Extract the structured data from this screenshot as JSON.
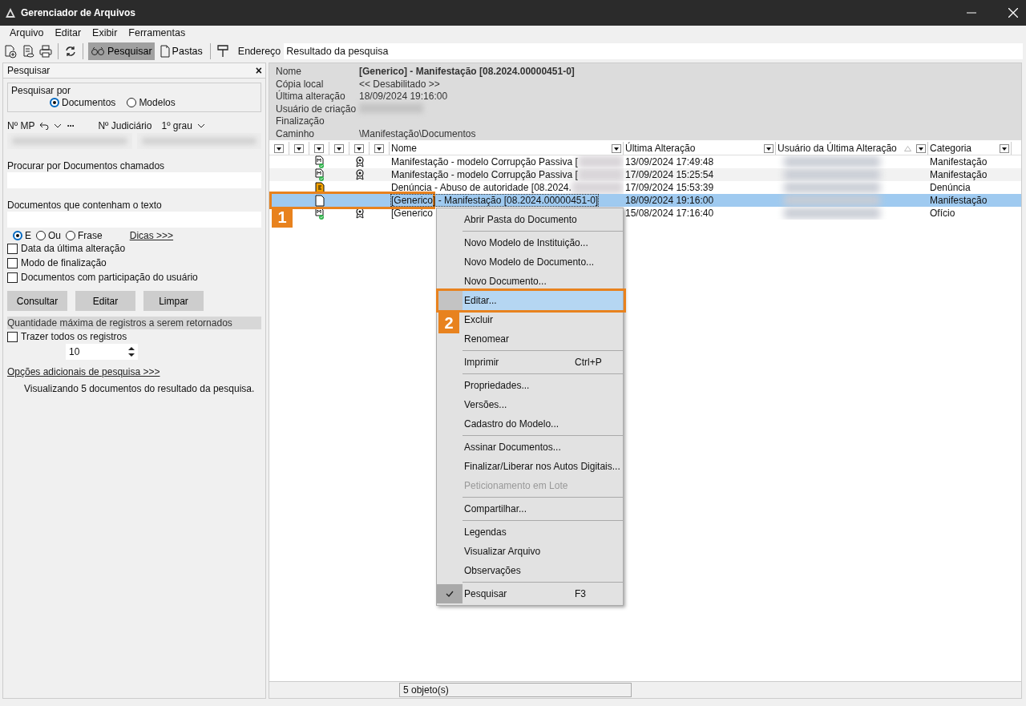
{
  "window": {
    "title": "Gerenciador de Arquivos"
  },
  "menu": [
    "Arquivo",
    "Editar",
    "Exibir",
    "Ferramentas"
  ],
  "toolbar": {
    "search_button": {
      "label": "Pesquisar",
      "selected": true
    },
    "folders_button": {
      "label": "Pastas",
      "selected": false
    },
    "address_label": "Endereço",
    "address_value": "Resultado da pesquisa"
  },
  "search_panel": {
    "title": "Pesquisar",
    "close": "×",
    "group_label": "Pesquisar por",
    "scope": [
      {
        "label": "Documentos",
        "selected": true
      },
      {
        "label": "Modelos",
        "selected": false
      }
    ],
    "mp_label": "Nº MP",
    "more": "···",
    "judicial_label": "Nº Judiciário",
    "instance": "1º grau",
    "name_label": "Procurar por Documentos chamados",
    "text_label": "Documentos que contenham o texto",
    "mode": [
      {
        "label": "E",
        "selected": true
      },
      {
        "label": "Ou",
        "selected": false
      },
      {
        "label": "Frase",
        "selected": false
      }
    ],
    "tips_link": "Dicas >>>",
    "filters": [
      {
        "label": "Data da última alteração",
        "checked": false
      },
      {
        "label": "Modo de finalização",
        "checked": false
      },
      {
        "label": "Documentos com participação do usuário",
        "checked": false
      }
    ],
    "buttons": [
      "Consultar",
      "Editar",
      "Limpar"
    ],
    "max_label": "Quantidade máxima de registros a serem retornados",
    "all_records": {
      "label": "Trazer todos os registros",
      "checked": false
    },
    "max_value": "10",
    "more_link": "Opções adicionais de pesquisa >>>",
    "summary": "Visualizando 5 documentos do resultado da pesquisa."
  },
  "details": [
    {
      "label": "Nome",
      "value": "[Generico] - Manifestação [08.2024.00000451-0]",
      "bold": true
    },
    {
      "label": "Cópia local",
      "value": "<< Desabilitado >>"
    },
    {
      "label": "Última alteração",
      "value": "18/09/2024 19:16:00"
    },
    {
      "label": "Usuário de criação",
      "blurred": true
    },
    {
      "label": "Finalização"
    },
    {
      "label": "Caminho",
      "value": "\\Manifestação\\Documentos"
    }
  ],
  "table": {
    "columns": [
      "Nome",
      "Última Alteração",
      "Usuário da Última Alteração",
      "Categoria"
    ],
    "rows": [
      {
        "kind": "model",
        "seal": true,
        "name": "Manifestação - modelo Corrupção Passiva [",
        "date": "13/09/2024 17:49:48",
        "category": "Manifestação",
        "selected": false
      },
      {
        "kind": "model",
        "seal": true,
        "name": "Manifestação - modelo Corrupção Passiva [",
        "date": "17/09/2024 15:25:54",
        "category": "Manifestação",
        "selected": false
      },
      {
        "kind": "complaint",
        "seal": false,
        "name": "Denúncia - Abuso de autoridade [08.2024.",
        "date": "17/09/2024 15:53:39",
        "category": "Denúncia",
        "selected": false
      },
      {
        "kind": "blank",
        "seal": false,
        "name": "[Generico] - Manifestação [08.2024.00000451-0]",
        "date": "18/09/2024 19:16:00",
        "category": "Manifestação",
        "selected": true
      },
      {
        "kind": "model",
        "seal": true,
        "name": "[Generico",
        "date": "15/08/2024 17:16:40",
        "category": "Ofício",
        "selected": false
      }
    ]
  },
  "status_bar": "5 objeto(s)",
  "context_menu": [
    {
      "kind": "item",
      "label": "Abrir Pasta do Documento",
      "selected": false
    },
    {
      "kind": "separator"
    },
    {
      "kind": "item",
      "label": "Novo Modelo de Instituição...",
      "selected": false
    },
    {
      "kind": "item",
      "label": "Novo Modelo de Documento...",
      "selected": false
    },
    {
      "kind": "item",
      "label": "Novo Documento...",
      "selected": false
    },
    {
      "kind": "item",
      "label": "Editar...",
      "selected": true,
      "callout": "2"
    },
    {
      "kind": "item",
      "label": "Excluir",
      "selected": false
    },
    {
      "kind": "item",
      "label": "Renomear",
      "selected": false
    },
    {
      "kind": "separator"
    },
    {
      "kind": "item",
      "label": "Imprimir",
      "shortcut": "Ctrl+P",
      "selected": false
    },
    {
      "kind": "separator"
    },
    {
      "kind": "item",
      "label": "Propriedades...",
      "selected": false
    },
    {
      "kind": "item",
      "label": "Versões...",
      "selected": false
    },
    {
      "kind": "item",
      "label": "Cadastro do Modelo...",
      "selected": false
    },
    {
      "kind": "separator"
    },
    {
      "kind": "item",
      "label": "Assinar Documentos...",
      "selected": false
    },
    {
      "kind": "item",
      "label": "Finalizar/Liberar nos Autos Digitais...",
      "selected": false
    },
    {
      "kind": "item",
      "label": "Peticionamento em Lote",
      "disabled": true,
      "selected": false
    },
    {
      "kind": "separator"
    },
    {
      "kind": "item",
      "label": "Compartilhar...",
      "selected": false
    },
    {
      "kind": "separator"
    },
    {
      "kind": "item",
      "label": "Legendas",
      "selected": false
    },
    {
      "kind": "item",
      "label": "Visualizar Arquivo",
      "selected": false
    },
    {
      "kind": "item",
      "label": "Observações",
      "selected": false
    },
    {
      "kind": "separator"
    },
    {
      "kind": "item",
      "label": "Pesquisar",
      "shortcut": "F3",
      "checked": true,
      "selected": false
    }
  ],
  "row_callout": "1"
}
